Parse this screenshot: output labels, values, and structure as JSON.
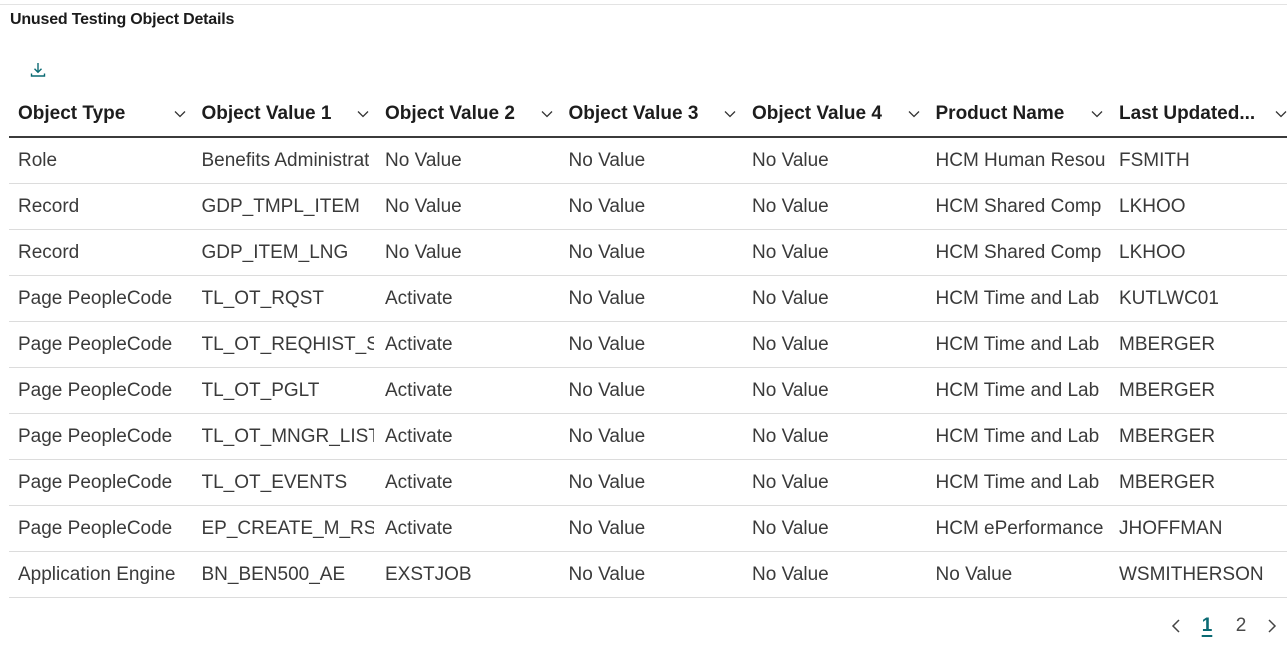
{
  "panel": {
    "title": "Unused Testing Object Details"
  },
  "toolbar": {
    "download_icon": "download-icon"
  },
  "table": {
    "columns": [
      "Object Type",
      "Object Value 1",
      "Object Value 2",
      "Object Value 3",
      "Object Value 4",
      "Product Name",
      "Last Updated..."
    ],
    "rows": [
      [
        "Role",
        "Benefits Administrat",
        "No Value",
        "No Value",
        "No Value",
        "HCM Human Resou",
        "FSMITH"
      ],
      [
        "Record",
        "GDP_TMPL_ITEM",
        "No Value",
        "No Value",
        "No Value",
        "HCM Shared Comp",
        "LKHOO"
      ],
      [
        "Record",
        "GDP_ITEM_LNG",
        "No Value",
        "No Value",
        "No Value",
        "HCM Shared Comp",
        "LKHOO"
      ],
      [
        "Page PeopleCode",
        "TL_OT_RQST",
        "Activate",
        "No Value",
        "No Value",
        "HCM Time and Lab",
        "KUTLWC01"
      ],
      [
        "Page PeopleCode",
        "TL_OT_REQHIST_S",
        "Activate",
        "No Value",
        "No Value",
        "HCM Time and Lab",
        "MBERGER"
      ],
      [
        "Page PeopleCode",
        "TL_OT_PGLT",
        "Activate",
        "No Value",
        "No Value",
        "HCM Time and Lab",
        "MBERGER"
      ],
      [
        "Page PeopleCode",
        "TL_OT_MNGR_LIST",
        "Activate",
        "No Value",
        "No Value",
        "HCM Time and Lab",
        "MBERGER"
      ],
      [
        "Page PeopleCode",
        "TL_OT_EVENTS",
        "Activate",
        "No Value",
        "No Value",
        "HCM Time and Lab",
        "MBERGER"
      ],
      [
        "Page PeopleCode",
        "EP_CREATE_M_RS_",
        "Activate",
        "No Value",
        "No Value",
        "HCM ePerformance",
        "JHOFFMAN"
      ],
      [
        "Application Engine",
        "BN_BEN500_AE",
        "EXSTJOB",
        "No Value",
        "No Value",
        "No Value",
        "WSMITHERSON"
      ]
    ]
  },
  "pagination": {
    "pages": [
      "1",
      "2"
    ],
    "current": "1"
  }
}
